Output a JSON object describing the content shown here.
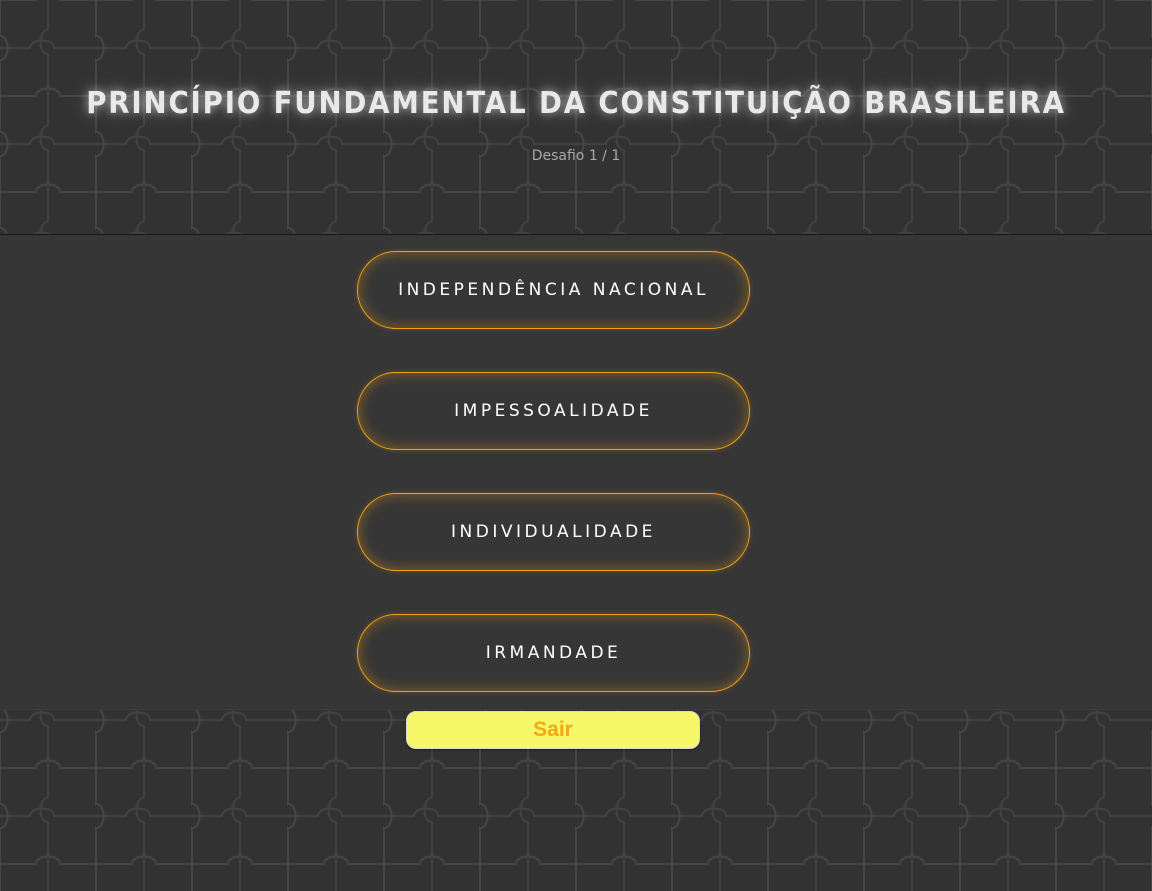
{
  "quiz": {
    "title": "PRINCÍPIO FUNDAMENTAL DA CONSTITUIÇÃO BRASILEIRA",
    "progress_text": "Desafio 1 / 1",
    "options": [
      {
        "label": "INDEPENDÊNCIA NACIONAL"
      },
      {
        "label": "IMPESSOALIDADE"
      },
      {
        "label": "INDIVIDUALIDADE"
      },
      {
        "label": "IRMANDADE"
      }
    ],
    "exit_label": "Sair"
  },
  "colors": {
    "background": "#333333",
    "accent_orange": "#f0a018",
    "exit_button_bg": "#f7f76a",
    "exit_button_text": "#f3a712",
    "title_text": "#e9e9e9"
  },
  "icons": {
    "background_pattern": "puzzle-pattern-icon"
  }
}
